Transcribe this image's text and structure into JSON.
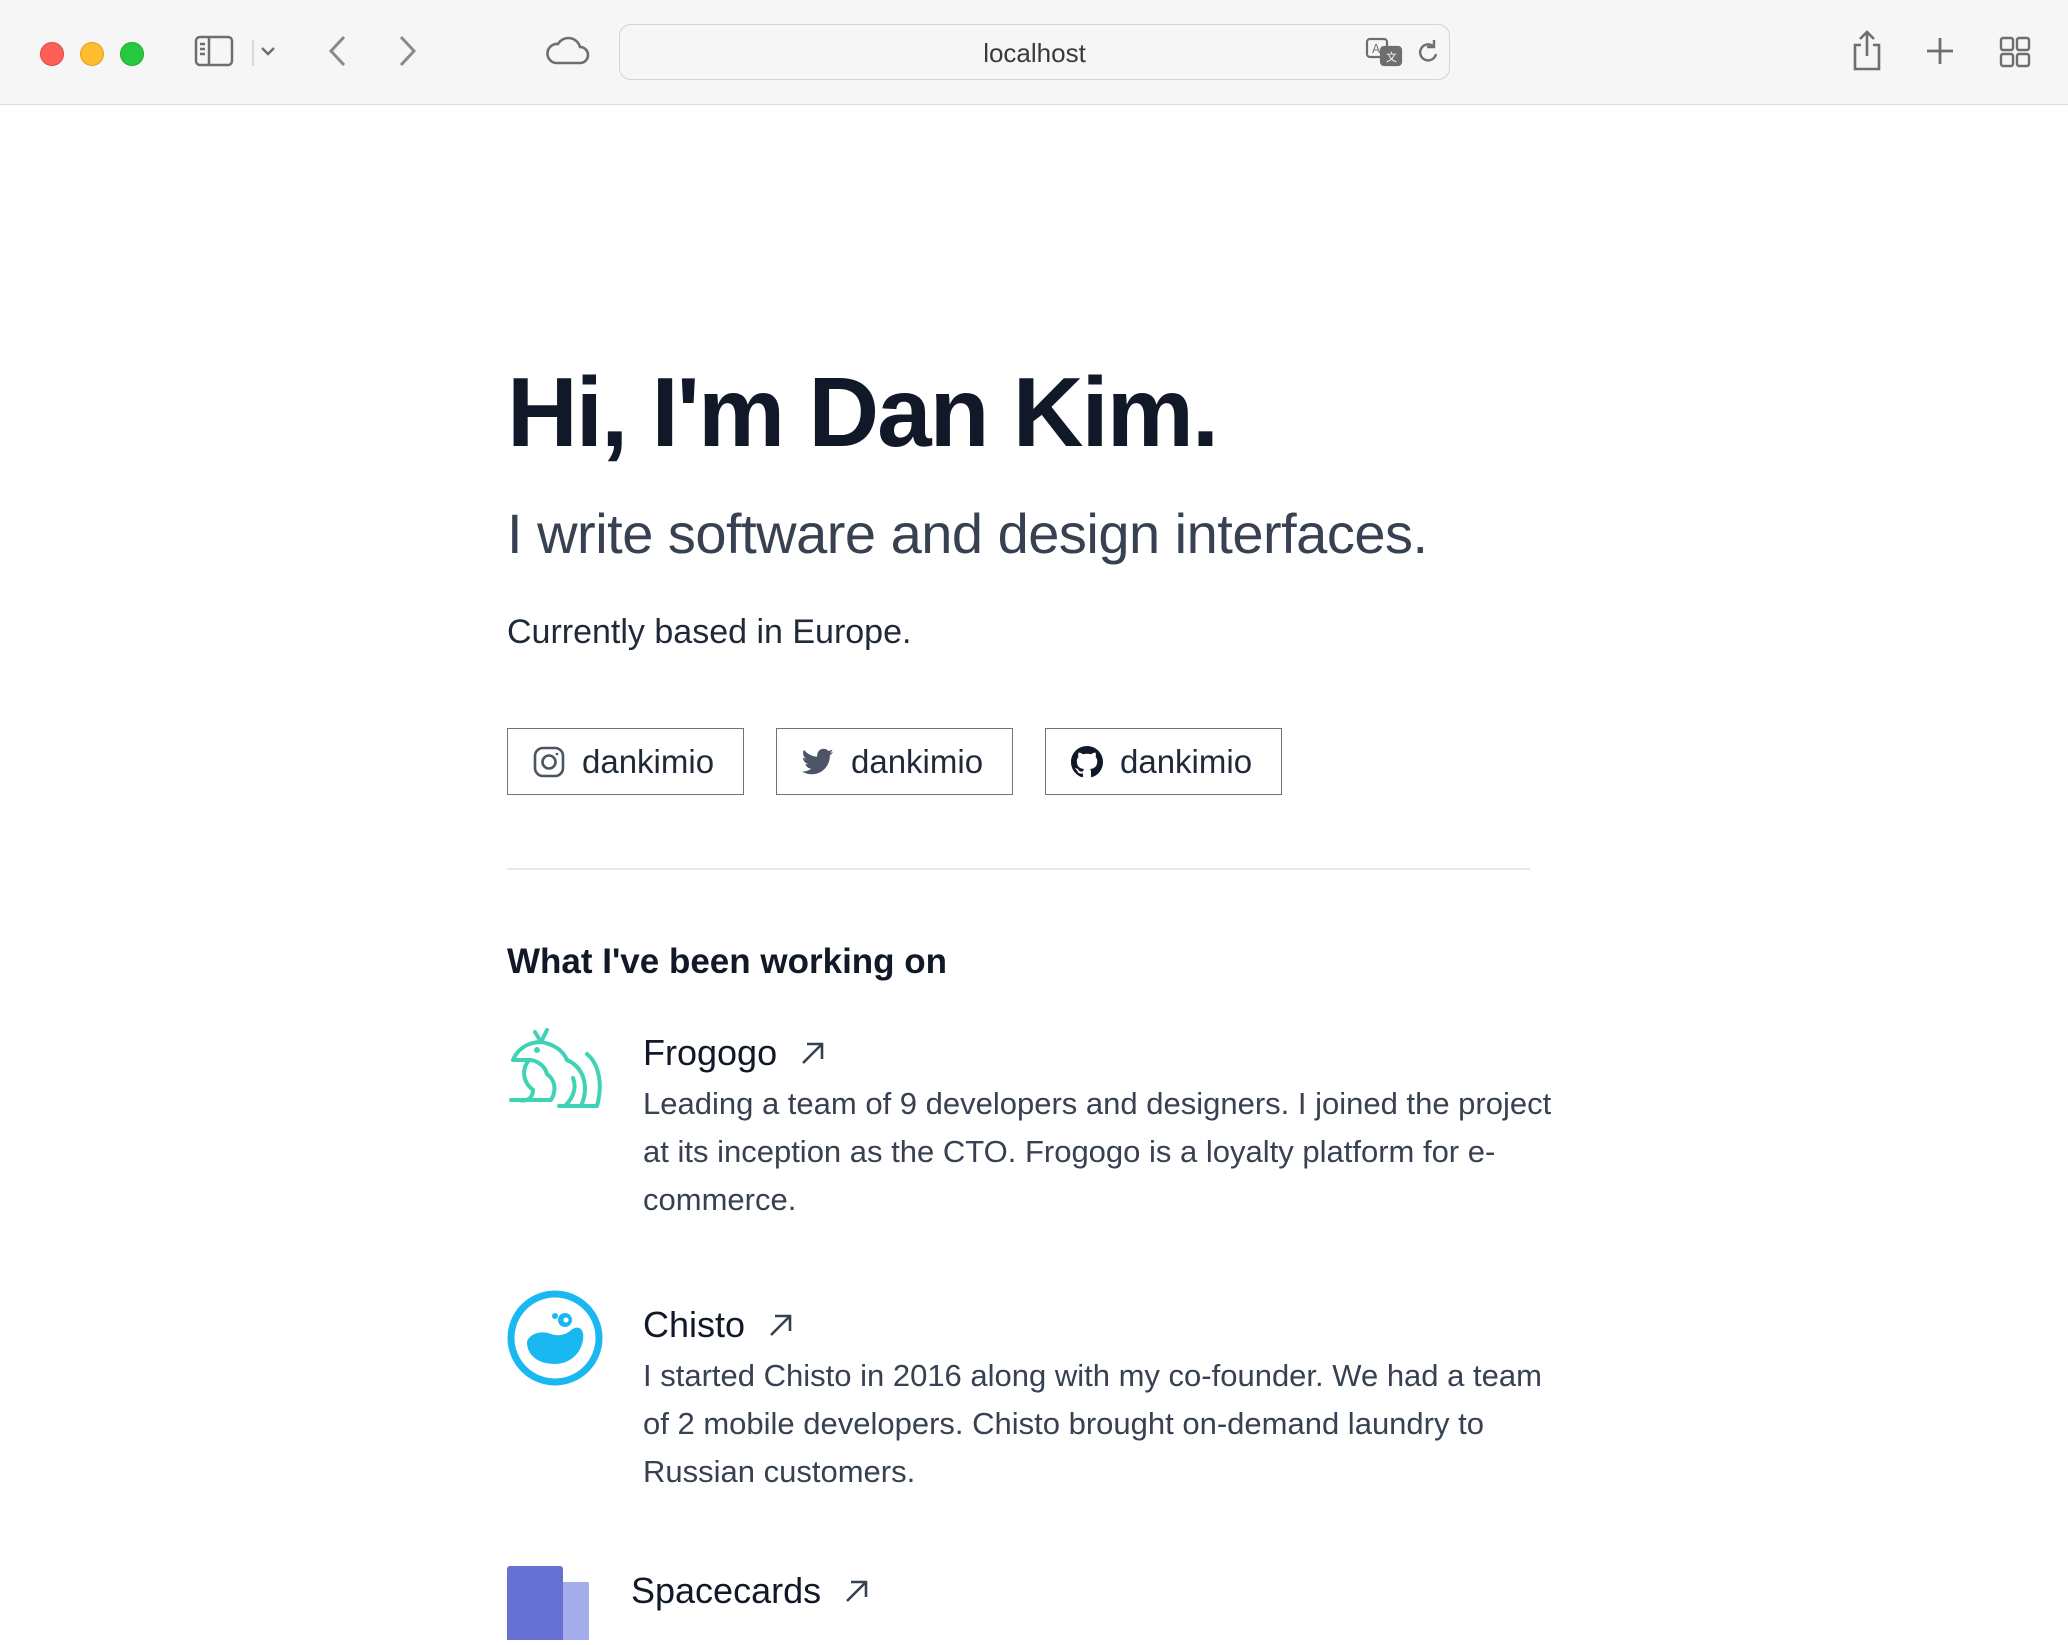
{
  "browser": {
    "address": "localhost",
    "icons": [
      "sidebar-icon",
      "chevron-down-icon",
      "back-icon",
      "forward-icon",
      "icloud-icon",
      "translate-icon",
      "reload-icon",
      "share-icon",
      "new-tab-icon",
      "tab-overview-icon"
    ]
  },
  "hero": {
    "title": "Hi, I'm Dan Kim.",
    "subtitle": "I write software and design interfaces.",
    "location": "Currently based in Europe."
  },
  "social": [
    {
      "label": "dankimio",
      "icon": "instagram-icon"
    },
    {
      "label": "dankimio",
      "icon": "twitter-icon"
    },
    {
      "label": "dankimio",
      "icon": "github-icon"
    }
  ],
  "work": {
    "title": "What I've been working on",
    "projects": [
      {
        "name": "Frogogo",
        "icon": "frogogo-logo",
        "description": "Leading a team of 9 developers and designers. I joined the project at its inception as the CTO. Frogogo is a loyalty platform for e-commerce."
      },
      {
        "name": "Chisto",
        "icon": "chisto-logo",
        "description": "I started Chisto in 2016 along with my co-founder. We had a team of 2 mobile developers. Chisto brought on-demand laundry to Russian customers."
      },
      {
        "name": "Spacecards",
        "icon": "spacecards-logo",
        "description": ""
      }
    ]
  },
  "colors": {
    "heading": "#111827",
    "body": "#374151",
    "frogogo": "#3ed3b4",
    "chisto": "#1ab8f0",
    "spacecards_dark": "#6570d2",
    "spacecards_light": "#a5acea"
  }
}
